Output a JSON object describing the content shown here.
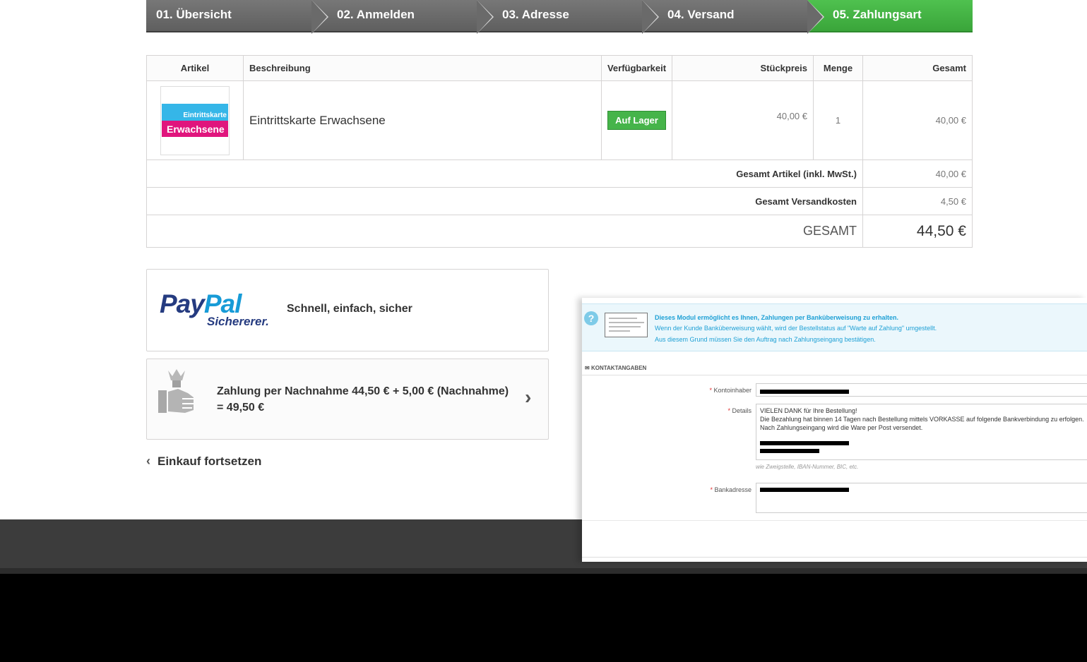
{
  "steps": [
    {
      "label": "01. Übersicht",
      "active": false
    },
    {
      "label": "02. Anmelden",
      "active": false
    },
    {
      "label": "03. Adresse",
      "active": false
    },
    {
      "label": "04. Versand",
      "active": false
    },
    {
      "label": "05. Zahlungsart",
      "active": true
    }
  ],
  "table": {
    "headers": {
      "article": "Artikel",
      "description": "Beschreibung",
      "availability": "Verfügbarkeit",
      "unit_price": "Stückpreis",
      "quantity": "Menge",
      "total": "Gesamt"
    },
    "item": {
      "image_text_top": "Eintrittskarte",
      "image_text_bottom": "Erwachsene",
      "description": "Eintrittskarte Erwachsene",
      "availability": "Auf Lager",
      "unit_price": "40,00 €",
      "quantity": "1",
      "total": "40,00 €"
    },
    "summary": {
      "products_label": "Gesamt Artikel (inkl. MwSt.)",
      "products_value": "40,00 €",
      "shipping_label": "Gesamt Versandkosten",
      "shipping_value": "4,50 €",
      "grand_label": "GESAMT",
      "grand_value": "44,50 €"
    }
  },
  "payment": {
    "paypal": {
      "logo_pay": "Pay",
      "logo_pal": "Pal",
      "logo_sub": "Sichererer.",
      "text": "Schnell, einfach, sicher"
    },
    "cod": {
      "text": "Zahlung per Nachnahme 44,50 € + 5,00 € (Nachnahme) = 49,50 €"
    }
  },
  "continue_label": "Einkauf fortsetzen",
  "admin": {
    "info_line1": "Dieses Modul ermöglicht es Ihnen, Zahlungen per Banküberweisung zu erhalten.",
    "info_line2": "Wenn der Kunde Banküberweisung wählt, wird der Bestellstatus auf \"Warte auf Zahlung\" umgestellt.",
    "info_line3": "Aus diesem Grund müssen Sie den Auftrag nach Zahlungseingang bestätigen.",
    "section_title": "KONTAKTANGABEN",
    "owner_label": "Kontoinhaber",
    "details_label": "Details",
    "details_line1": "VIELEN DANK für Ihre Bestellung!",
    "details_line2": "Die Bezahlung hat binnen 14 Tagen nach Bestellung mittels VORKASSE auf folgende Bankverbindung zu erfolgen.",
    "details_line3": "Nach Zahlungseingang wird die Ware per Post versendet.",
    "details_hint": "wie Zweigstelle, IBAN-Nummer, BIC, etc.",
    "address_label": "Bankadresse"
  },
  "colors": {
    "active_step": "#46b44a",
    "inactive_step": "#666666",
    "badge": "#46b44a",
    "paypal_dark": "#253b80",
    "paypal_light": "#179bd7",
    "admin_info": "#1ea0d5"
  }
}
